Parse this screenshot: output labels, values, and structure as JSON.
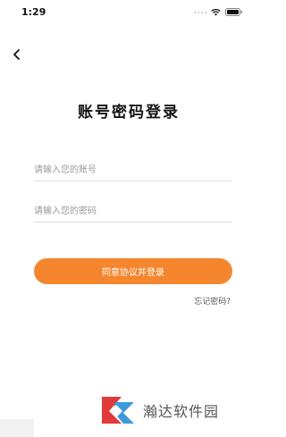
{
  "status_bar": {
    "time": "1:29",
    "icons": [
      "signal-dots-icon",
      "wifi-icon",
      "battery-icon"
    ]
  },
  "nav": {
    "back_icon": "chevron-left-icon"
  },
  "title": "账号密码登录",
  "form": {
    "account_placeholder": "请输入您的账号",
    "account_value": "",
    "password_placeholder": "请输入您的密码",
    "password_value": ""
  },
  "login_button_label": "同意协议并登录",
  "forgot_password_label": "忘记密码?",
  "watermark": {
    "text": "瀚达软件园",
    "logo_icon": "watermark-logo-icon"
  },
  "colors": {
    "accent": "#f5862e",
    "watermark_red": "#e23a3a",
    "watermark_blue": "#2a8fd6"
  }
}
